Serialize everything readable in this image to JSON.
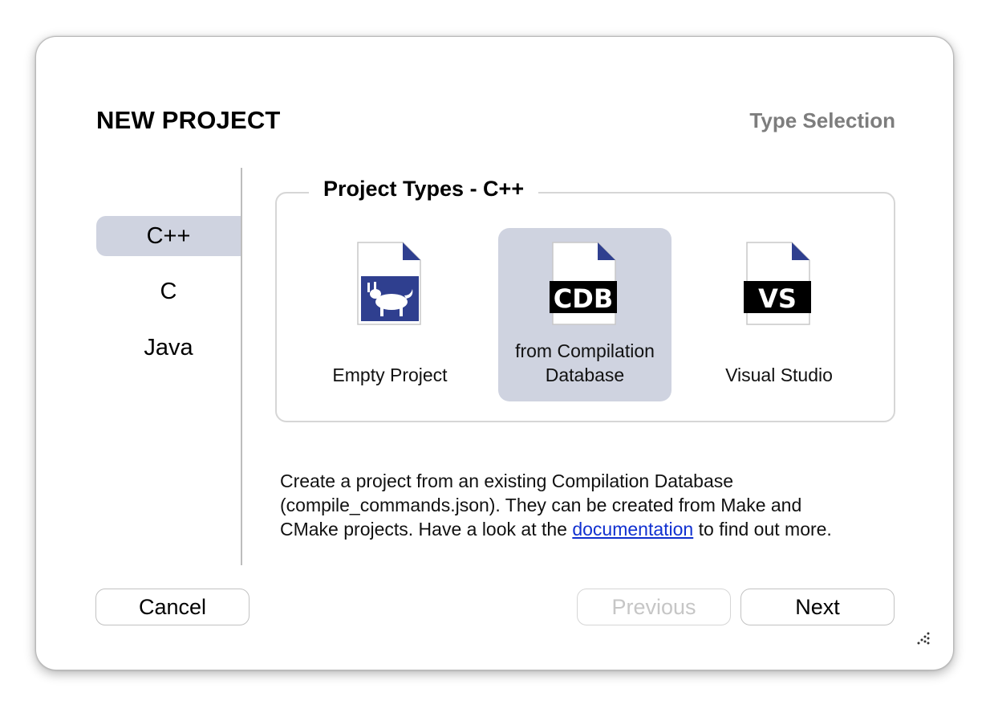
{
  "dialog": {
    "title": "NEW PROJECT",
    "step": "Type Selection"
  },
  "sidebar": {
    "items": [
      {
        "label": "C++",
        "selected": true
      },
      {
        "label": "C",
        "selected": false
      },
      {
        "label": "Java",
        "selected": false
      }
    ]
  },
  "group": {
    "title": "Project Types - C++",
    "types": [
      {
        "icon": "empty-project-icon",
        "label": "Empty Project",
        "selected": false
      },
      {
        "icon": "cdb-file-icon",
        "icon_text": "CDB",
        "label_line1": "from Compilation",
        "label_line2": "Database",
        "selected": true
      },
      {
        "icon": "vs-file-icon",
        "icon_text": "VS",
        "label": "Visual Studio",
        "selected": false
      }
    ]
  },
  "description": {
    "line1": "Create a project from an existing Compilation Database",
    "line2": "(compile_commands.json). They can be created from Make and",
    "line3_before": "CMake projects. Have a look at the ",
    "link": "documentation",
    "line3_after": " to find out more."
  },
  "buttons": {
    "cancel": "Cancel",
    "previous": "Previous",
    "next": "Next"
  },
  "colors": {
    "selection": "#cfd3e0",
    "link": "#1030d0",
    "icon_blue": "#2f3f8f"
  }
}
